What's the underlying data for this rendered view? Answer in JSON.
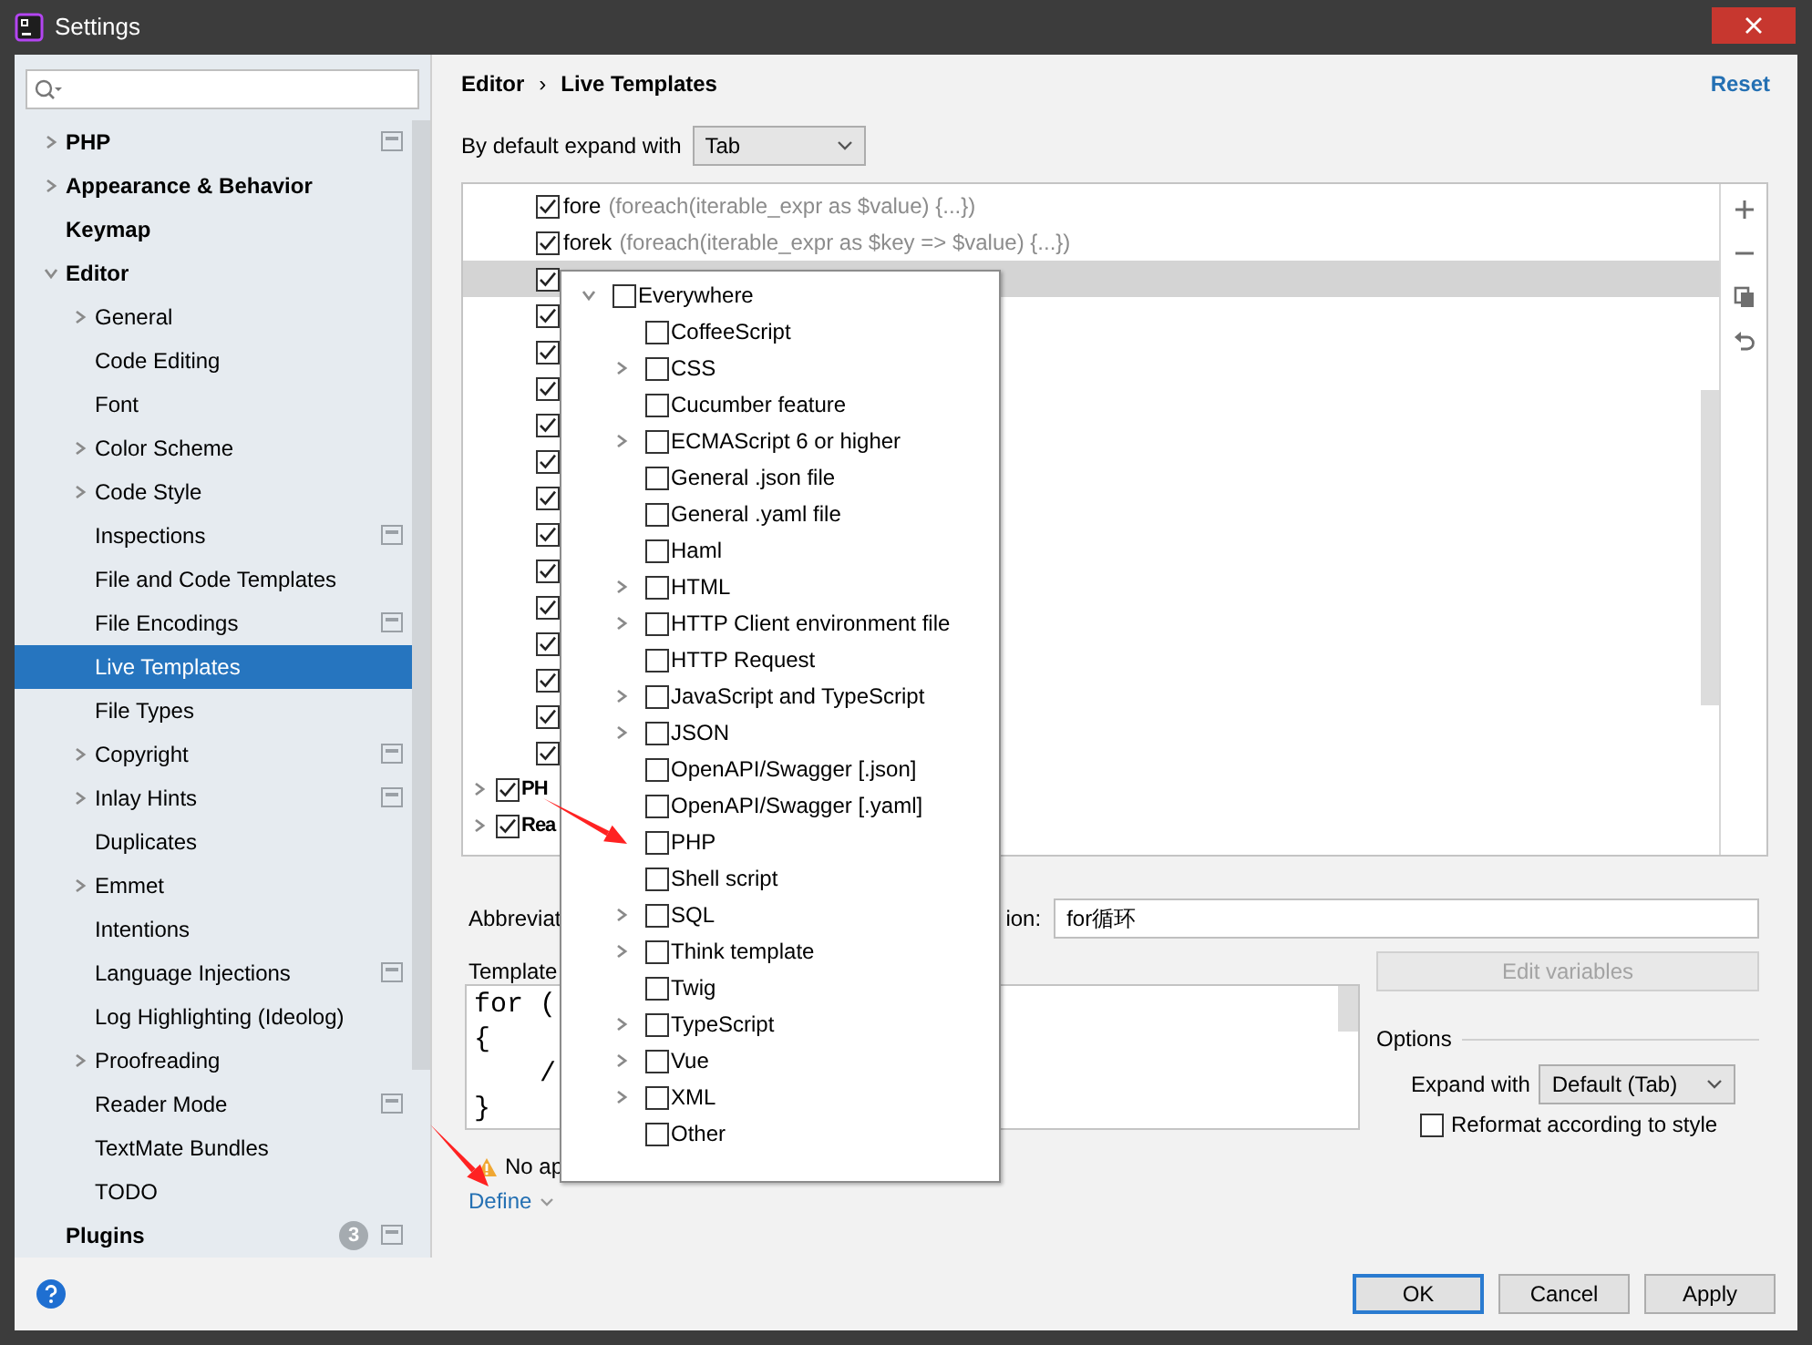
{
  "window": {
    "title": "Settings"
  },
  "sidebar": {
    "items": [
      {
        "label": "PHP",
        "expanded": false,
        "project": true,
        "selected": false
      },
      {
        "label": "Appearance & Behavior",
        "expanded": false,
        "selected": false
      },
      {
        "label": "Keymap",
        "selected": false
      },
      {
        "label": "Editor",
        "expanded": true,
        "selected": false,
        "children": [
          {
            "label": "General",
            "expanded": false,
            "selected": false
          },
          {
            "label": "Code Editing",
            "selected": false
          },
          {
            "label": "Font",
            "selected": false
          },
          {
            "label": "Color Scheme",
            "expanded": false,
            "selected": false
          },
          {
            "label": "Code Style",
            "expanded": false,
            "selected": false
          },
          {
            "label": "Inspections",
            "project": true,
            "selected": false
          },
          {
            "label": "File and Code Templates",
            "selected": false
          },
          {
            "label": "File Encodings",
            "project": true,
            "selected": false
          },
          {
            "label": "Live Templates",
            "selected": true
          },
          {
            "label": "File Types",
            "selected": false
          },
          {
            "label": "Copyright",
            "expanded": false,
            "project": true,
            "selected": false
          },
          {
            "label": "Inlay Hints",
            "expanded": false,
            "project": true,
            "selected": false
          },
          {
            "label": "Duplicates",
            "selected": false
          },
          {
            "label": "Emmet",
            "expanded": false,
            "selected": false
          },
          {
            "label": "Intentions",
            "selected": false
          },
          {
            "label": "Language Injections",
            "project": true,
            "selected": false
          },
          {
            "label": "Log Highlighting (Ideolog)",
            "selected": false
          },
          {
            "label": "Proofreading",
            "expanded": false,
            "selected": false
          },
          {
            "label": "Reader Mode",
            "project": true,
            "selected": false
          },
          {
            "label": "TextMate Bundles",
            "selected": false
          },
          {
            "label": "TODO",
            "selected": false
          }
        ]
      },
      {
        "label": "Plugins",
        "badge": "3",
        "project": true,
        "selected": false
      }
    ]
  },
  "breadcrumb": [
    "Editor",
    "›",
    "Live Templates"
  ],
  "reset_link": "Reset",
  "expand_default": {
    "label": "By default expand with",
    "value": "Tab"
  },
  "templates": [
    {
      "kind": "template",
      "abbreviation": "fore",
      "description": "(foreach(iterable_expr as $value) {...})",
      "checked": true,
      "selected": false
    },
    {
      "kind": "template",
      "abbreviation": "forek",
      "description": "(foreach(iterable_expr as $key => $value) {...})",
      "checked": true,
      "selected": false
    },
    {
      "kind": "template",
      "checked": true,
      "selected": true
    },
    {
      "kind": "template",
      "checked": true,
      "selected": false
    },
    {
      "kind": "template",
      "checked": true,
      "selected": false
    },
    {
      "kind": "template",
      "checked": true,
      "selected": false
    },
    {
      "kind": "template",
      "checked": true,
      "selected": false
    },
    {
      "kind": "template",
      "checked": true,
      "selected": false
    },
    {
      "kind": "template",
      "checked": true,
      "selected": false
    },
    {
      "kind": "template",
      "checked": true,
      "selected": false
    },
    {
      "kind": "template",
      "checked": true,
      "selected": false
    },
    {
      "kind": "template",
      "checked": true,
      "selected": false
    },
    {
      "kind": "template",
      "checked": true,
      "selected": false
    },
    {
      "kind": "template",
      "checked": true,
      "selected": false
    },
    {
      "kind": "template",
      "checked": true,
      "selected": false
    },
    {
      "kind": "template",
      "checked": true,
      "selected": false
    },
    {
      "kind": "group",
      "name": "PH",
      "checked": true,
      "expanded": false,
      "selected": false
    },
    {
      "kind": "group",
      "name": "Rea",
      "checked": true,
      "expanded": false,
      "selected": false
    }
  ],
  "abbreviation_label": "Abbreviat",
  "description": {
    "label": "ion:",
    "value": "for循环"
  },
  "template_text": {
    "label": "Template",
    "lines": [
      "for (",
      "{",
      "    /",
      "}"
    ]
  },
  "edit_variables": {
    "label": "Edit variables",
    "disabled": true
  },
  "options": {
    "title": "Options",
    "expand_label": "Expand with",
    "expand_value": "Default (Tab)",
    "reformat": {
      "label": "Reformat according to style",
      "checked": false
    }
  },
  "warning": "No ap",
  "define_link": "Define",
  "contexts": [
    {
      "label": "Everywhere",
      "checked": false,
      "expanded": true,
      "children": [
        {
          "label": "CoffeeScript",
          "checked": false
        },
        {
          "label": "CSS",
          "checked": false,
          "expanded": false
        },
        {
          "label": "Cucumber feature",
          "checked": false
        },
        {
          "label": "ECMAScript 6 or higher",
          "checked": false,
          "expanded": false
        },
        {
          "label": "General .json file",
          "checked": false
        },
        {
          "label": "General .yaml file",
          "checked": false
        },
        {
          "label": "Haml",
          "checked": false
        },
        {
          "label": "HTML",
          "checked": false,
          "expanded": false
        },
        {
          "label": "HTTP Client environment file",
          "checked": false,
          "expanded": false
        },
        {
          "label": "HTTP Request",
          "checked": false
        },
        {
          "label": "JavaScript and TypeScript",
          "checked": false,
          "expanded": false
        },
        {
          "label": "JSON",
          "checked": false,
          "expanded": false
        },
        {
          "label": "OpenAPI/Swagger [.json]",
          "checked": false
        },
        {
          "label": "OpenAPI/Swagger [.yaml]",
          "checked": false
        },
        {
          "label": "PHP",
          "checked": false
        },
        {
          "label": "Shell script",
          "checked": false
        },
        {
          "label": "SQL",
          "checked": false,
          "expanded": false
        },
        {
          "label": "Think template",
          "checked": false,
          "expanded": false
        },
        {
          "label": "Twig",
          "checked": false
        },
        {
          "label": "TypeScript",
          "checked": false,
          "expanded": false
        },
        {
          "label": "Vue",
          "checked": false,
          "expanded": false
        },
        {
          "label": "XML",
          "checked": false,
          "expanded": false
        },
        {
          "label": "Other",
          "checked": false
        }
      ]
    }
  ],
  "buttons": [
    {
      "label": "OK",
      "primary": true
    },
    {
      "label": "Cancel",
      "primary": false
    },
    {
      "label": "Apply",
      "primary": false
    }
  ]
}
